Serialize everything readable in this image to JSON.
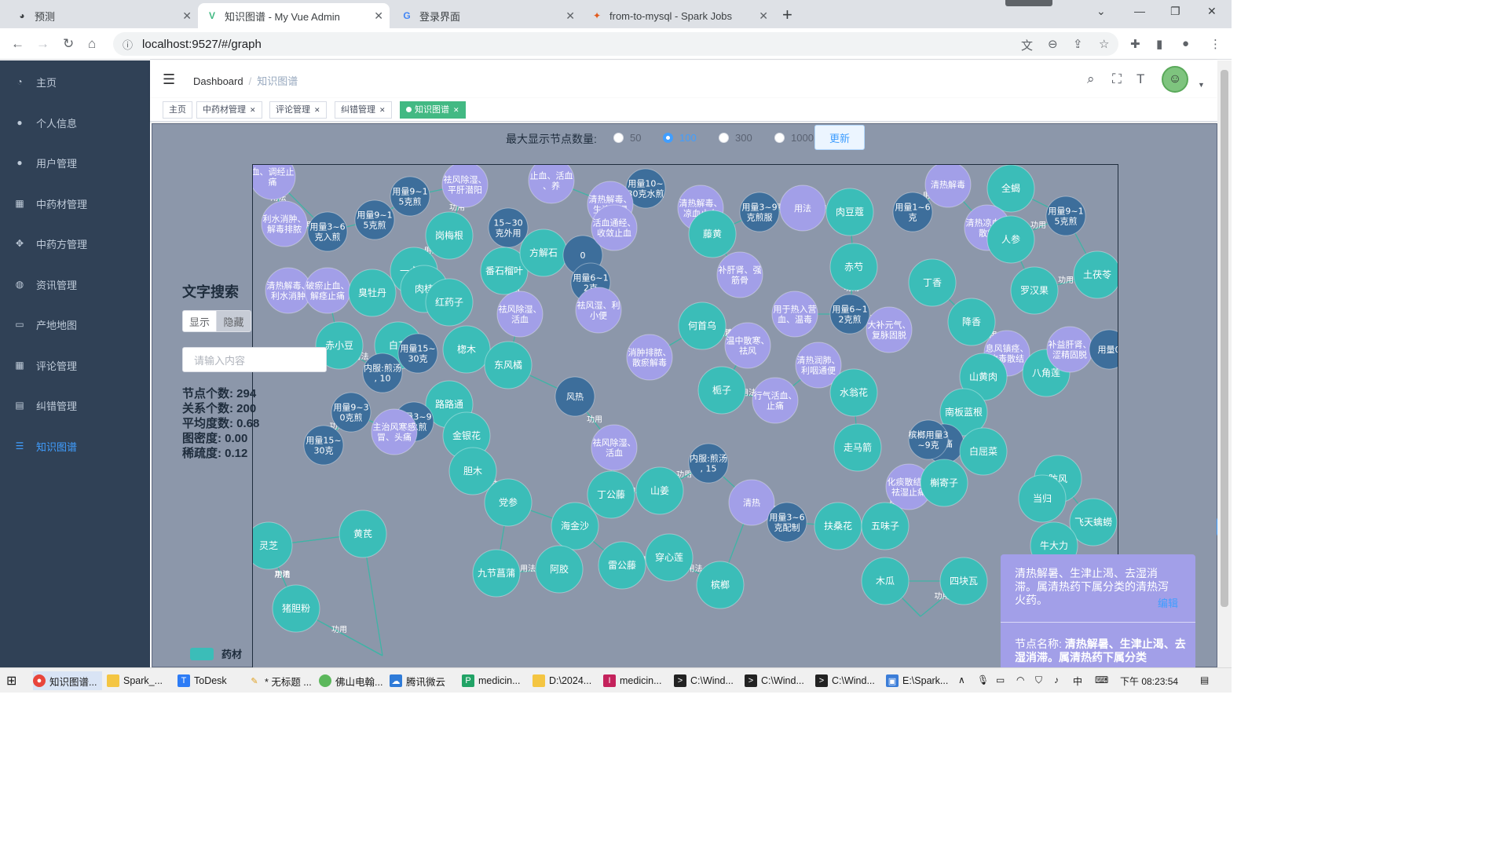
{
  "browser": {
    "tabs": [
      {
        "title": "预测"
      },
      {
        "title": "知识图谱 - My Vue Admin"
      },
      {
        "title": "登录界面"
      },
      {
        "title": "from-to-mysql - Spark Jobs"
      }
    ],
    "url": "localhost:9527/#/graph"
  },
  "sidebar": {
    "items": [
      {
        "label": "主页",
        "icon": "speedometer-icon"
      },
      {
        "label": "个人信息",
        "icon": "user-icon"
      },
      {
        "label": "用户管理",
        "icon": "user-manage-icon"
      },
      {
        "label": "中药材管理",
        "icon": "grid-icon"
      },
      {
        "label": "中药方管理",
        "icon": "move-icon"
      },
      {
        "label": "资讯管理",
        "icon": "globe-icon"
      },
      {
        "label": "产地地图",
        "icon": "map-icon"
      },
      {
        "label": "评论管理",
        "icon": "grid-icon"
      },
      {
        "label": "纠错管理",
        "icon": "document-icon"
      },
      {
        "label": "知识图谱",
        "icon": "list-icon"
      }
    ]
  },
  "breadcrumb": {
    "root": "Dashboard",
    "current": "知识图谱"
  },
  "tags": [
    {
      "label": "主页"
    },
    {
      "label": "中药材管理"
    },
    {
      "label": "评论管理"
    },
    {
      "label": "纠错管理"
    },
    {
      "label": "知识图谱"
    }
  ],
  "controls": {
    "max_nodes_label": "最大显示节点数量:",
    "options": [
      "50",
      "100",
      "300",
      "1000"
    ],
    "selected": "100",
    "update_label": "更新"
  },
  "search": {
    "title": "文字搜索",
    "show_label": "显示",
    "hide_label": "隐藏",
    "placeholder": "请输入内容"
  },
  "stats": {
    "node_count": "节点个数: 294",
    "rel_count": "关系个数: 200",
    "avg_degree": "平均度数: 0.68",
    "density": "图密度: 0.00",
    "sparsity": "稀疏度: 0.12"
  },
  "legend": {
    "label": "药材"
  },
  "info_panel": {
    "description": "清热解暑、生津止渴、去湿消滞。属清热药下属分类的清热泻火药。",
    "edit_label": "编辑",
    "node_prefix": "节点名称: ",
    "node_name": "清热解暑、生津止渴、去湿消滞。属清热药下属分类"
  },
  "colors": {
    "herb": "#3bbdb8",
    "dose": "#3d6e9b",
    "effect": "#a29fe8",
    "edge": "#3fb4a6",
    "bg": "#8c97aa",
    "sidebar": "#304156",
    "accent": "#409eff"
  },
  "graph": {
    "nodes": [
      {
        "label": "血、调经止痛",
        "type": "effect"
      },
      {
        "label": "用量9~15克煎",
        "type": "dose"
      },
      {
        "label": "祛风除湿、平肝潜阳",
        "type": "effect"
      },
      {
        "label": "止血、活血、养",
        "type": "effect"
      },
      {
        "label": "用量10~30克水煎",
        "type": "dose"
      },
      {
        "label": "利水消肿、解毒排脓",
        "type": "effect"
      },
      {
        "label": "用量3~6克入煎",
        "type": "dose"
      },
      {
        "label": "用量9~15克煎",
        "type": "dose"
      },
      {
        "label": "岗梅根",
        "type": "herb"
      },
      {
        "label": "15~30克外用",
        "type": "dose"
      },
      {
        "label": "清热解毒、生津止渴",
        "type": "effect"
      },
      {
        "label": "清热解毒、凉血止血",
        "type": "effect"
      },
      {
        "label": "用量3~9克煎服",
        "type": "dose"
      },
      {
        "label": "用法",
        "type": "effect"
      },
      {
        "label": "肉豆蔻",
        "type": "herb"
      },
      {
        "label": "用量1~6克",
        "type": "dose"
      },
      {
        "label": "清热解毒",
        "type": "effect"
      },
      {
        "label": "全蝎",
        "type": "herb"
      },
      {
        "label": "用量9~15克煎",
        "type": "dose"
      },
      {
        "label": "一点红",
        "type": "herb"
      },
      {
        "label": "番石榴叶",
        "type": "herb"
      },
      {
        "label": "方解石",
        "type": "herb"
      },
      {
        "label": "0",
        "type": "dose"
      },
      {
        "label": "活血通经、收敛止血",
        "type": "effect"
      },
      {
        "label": "藤黄",
        "type": "herb"
      },
      {
        "label": "补肝肾、强筋骨",
        "type": "effect"
      },
      {
        "label": "赤芍",
        "type": "herb"
      },
      {
        "label": "丁香",
        "type": "herb"
      },
      {
        "label": "清热凉血、散瘀",
        "type": "effect"
      },
      {
        "label": "人参",
        "type": "herb"
      },
      {
        "label": "土茯苓",
        "type": "herb"
      },
      {
        "label": "清热解毒、利水消肿",
        "type": "effect"
      },
      {
        "label": "破瘀止血、解痉止痛",
        "type": "effect"
      },
      {
        "label": "臭牡丹",
        "type": "herb"
      },
      {
        "label": "肉桂",
        "type": "herb"
      },
      {
        "label": "红药子",
        "type": "herb"
      },
      {
        "label": "用量6~12克",
        "type": "dose"
      },
      {
        "label": "祛风湿、利小便",
        "type": "effect"
      },
      {
        "label": "祛风除湿、活血",
        "type": "effect"
      },
      {
        "label": "用于热入营血、温毒",
        "type": "effect"
      },
      {
        "label": "用量6~12克煎",
        "type": "dose"
      },
      {
        "label": "大补元气、复脉固脱",
        "type": "effect"
      },
      {
        "label": "降香",
        "type": "herb"
      },
      {
        "label": "罗汉果",
        "type": "herb"
      },
      {
        "label": "赤小豆",
        "type": "herb"
      },
      {
        "label": "白芷",
        "type": "herb"
      },
      {
        "label": "用量15~30克",
        "type": "dose"
      },
      {
        "label": "楤木",
        "type": "herb"
      },
      {
        "label": "何首乌",
        "type": "herb"
      },
      {
        "label": "消肿排脓、散瘀解毒",
        "type": "effect"
      },
      {
        "label": "温中散寒、祛风",
        "type": "effect"
      },
      {
        "label": "清热润肺、利咽通便",
        "type": "effect"
      },
      {
        "label": "息风镇痉、攻毒散结",
        "type": "effect"
      },
      {
        "label": "八角莲",
        "type": "herb"
      },
      {
        "label": "补益肝肾、涩精固脱",
        "type": "effect"
      },
      {
        "label": "用量0",
        "type": "dose"
      },
      {
        "label": "内服:煎汤, 10",
        "type": "dose"
      },
      {
        "label": "东风橘",
        "type": "herb"
      },
      {
        "label": "风热",
        "type": "dose"
      },
      {
        "label": "栀子",
        "type": "herb"
      },
      {
        "label": "行气活血、止痛",
        "type": "effect"
      },
      {
        "label": "水翁花",
        "type": "herb"
      },
      {
        "label": "山黄肉",
        "type": "herb"
      },
      {
        "label": "南板蓝根",
        "type": "herb"
      },
      {
        "label": "路路通",
        "type": "herb"
      },
      {
        "label": "用量3~9克水煎",
        "type": "dose"
      },
      {
        "label": "用量9~30克煎",
        "type": "dose"
      },
      {
        "label": "主治风寒感冒、头痛",
        "type": "effect"
      },
      {
        "label": "金银花",
        "type": "herb"
      },
      {
        "label": "祛风除湿、活血",
        "type": "effect"
      },
      {
        "label": "内服:煎汤, 15",
        "type": "dose"
      },
      {
        "label": "走马箭",
        "type": "herb"
      },
      {
        "label": "头痛",
        "type": "dose"
      },
      {
        "label": "槟榔用量3~9克",
        "type": "dose"
      },
      {
        "label": "白屈菜",
        "type": "herb"
      },
      {
        "label": "用量15~30克",
        "type": "dose"
      },
      {
        "label": "胆木",
        "type": "herb"
      },
      {
        "label": "丁公藤",
        "type": "herb"
      },
      {
        "label": "山姜",
        "type": "herb"
      },
      {
        "label": "清热",
        "type": "effect"
      },
      {
        "label": "化痰散结、祛湿止痛",
        "type": "effect"
      },
      {
        "label": "槲寄子",
        "type": "herb"
      },
      {
        "label": "防风",
        "type": "herb"
      },
      {
        "label": "当归",
        "type": "herb"
      },
      {
        "label": "党参",
        "type": "herb"
      },
      {
        "label": "海金沙",
        "type": "herb"
      },
      {
        "label": "用量3~6克配制",
        "type": "dose"
      },
      {
        "label": "扶桑花",
        "type": "herb"
      },
      {
        "label": "五味子",
        "type": "herb"
      },
      {
        "label": "飞天蠄蟧",
        "type": "herb"
      },
      {
        "label": "灵芝",
        "type": "herb"
      },
      {
        "label": "黄芪",
        "type": "herb"
      },
      {
        "label": "九节菖蒲",
        "type": "herb"
      },
      {
        "label": "阿胶",
        "type": "herb"
      },
      {
        "label": "雷公藤",
        "type": "herb"
      },
      {
        "label": "穿心莲",
        "type": "herb"
      },
      {
        "label": "槟榔",
        "type": "herb"
      },
      {
        "label": "木瓜",
        "type": "herb"
      },
      {
        "label": "四块瓦",
        "type": "herb"
      },
      {
        "label": "牛大力",
        "type": "herb"
      },
      {
        "label": "猪胆粉",
        "type": "herb"
      }
    ]
  }
}
